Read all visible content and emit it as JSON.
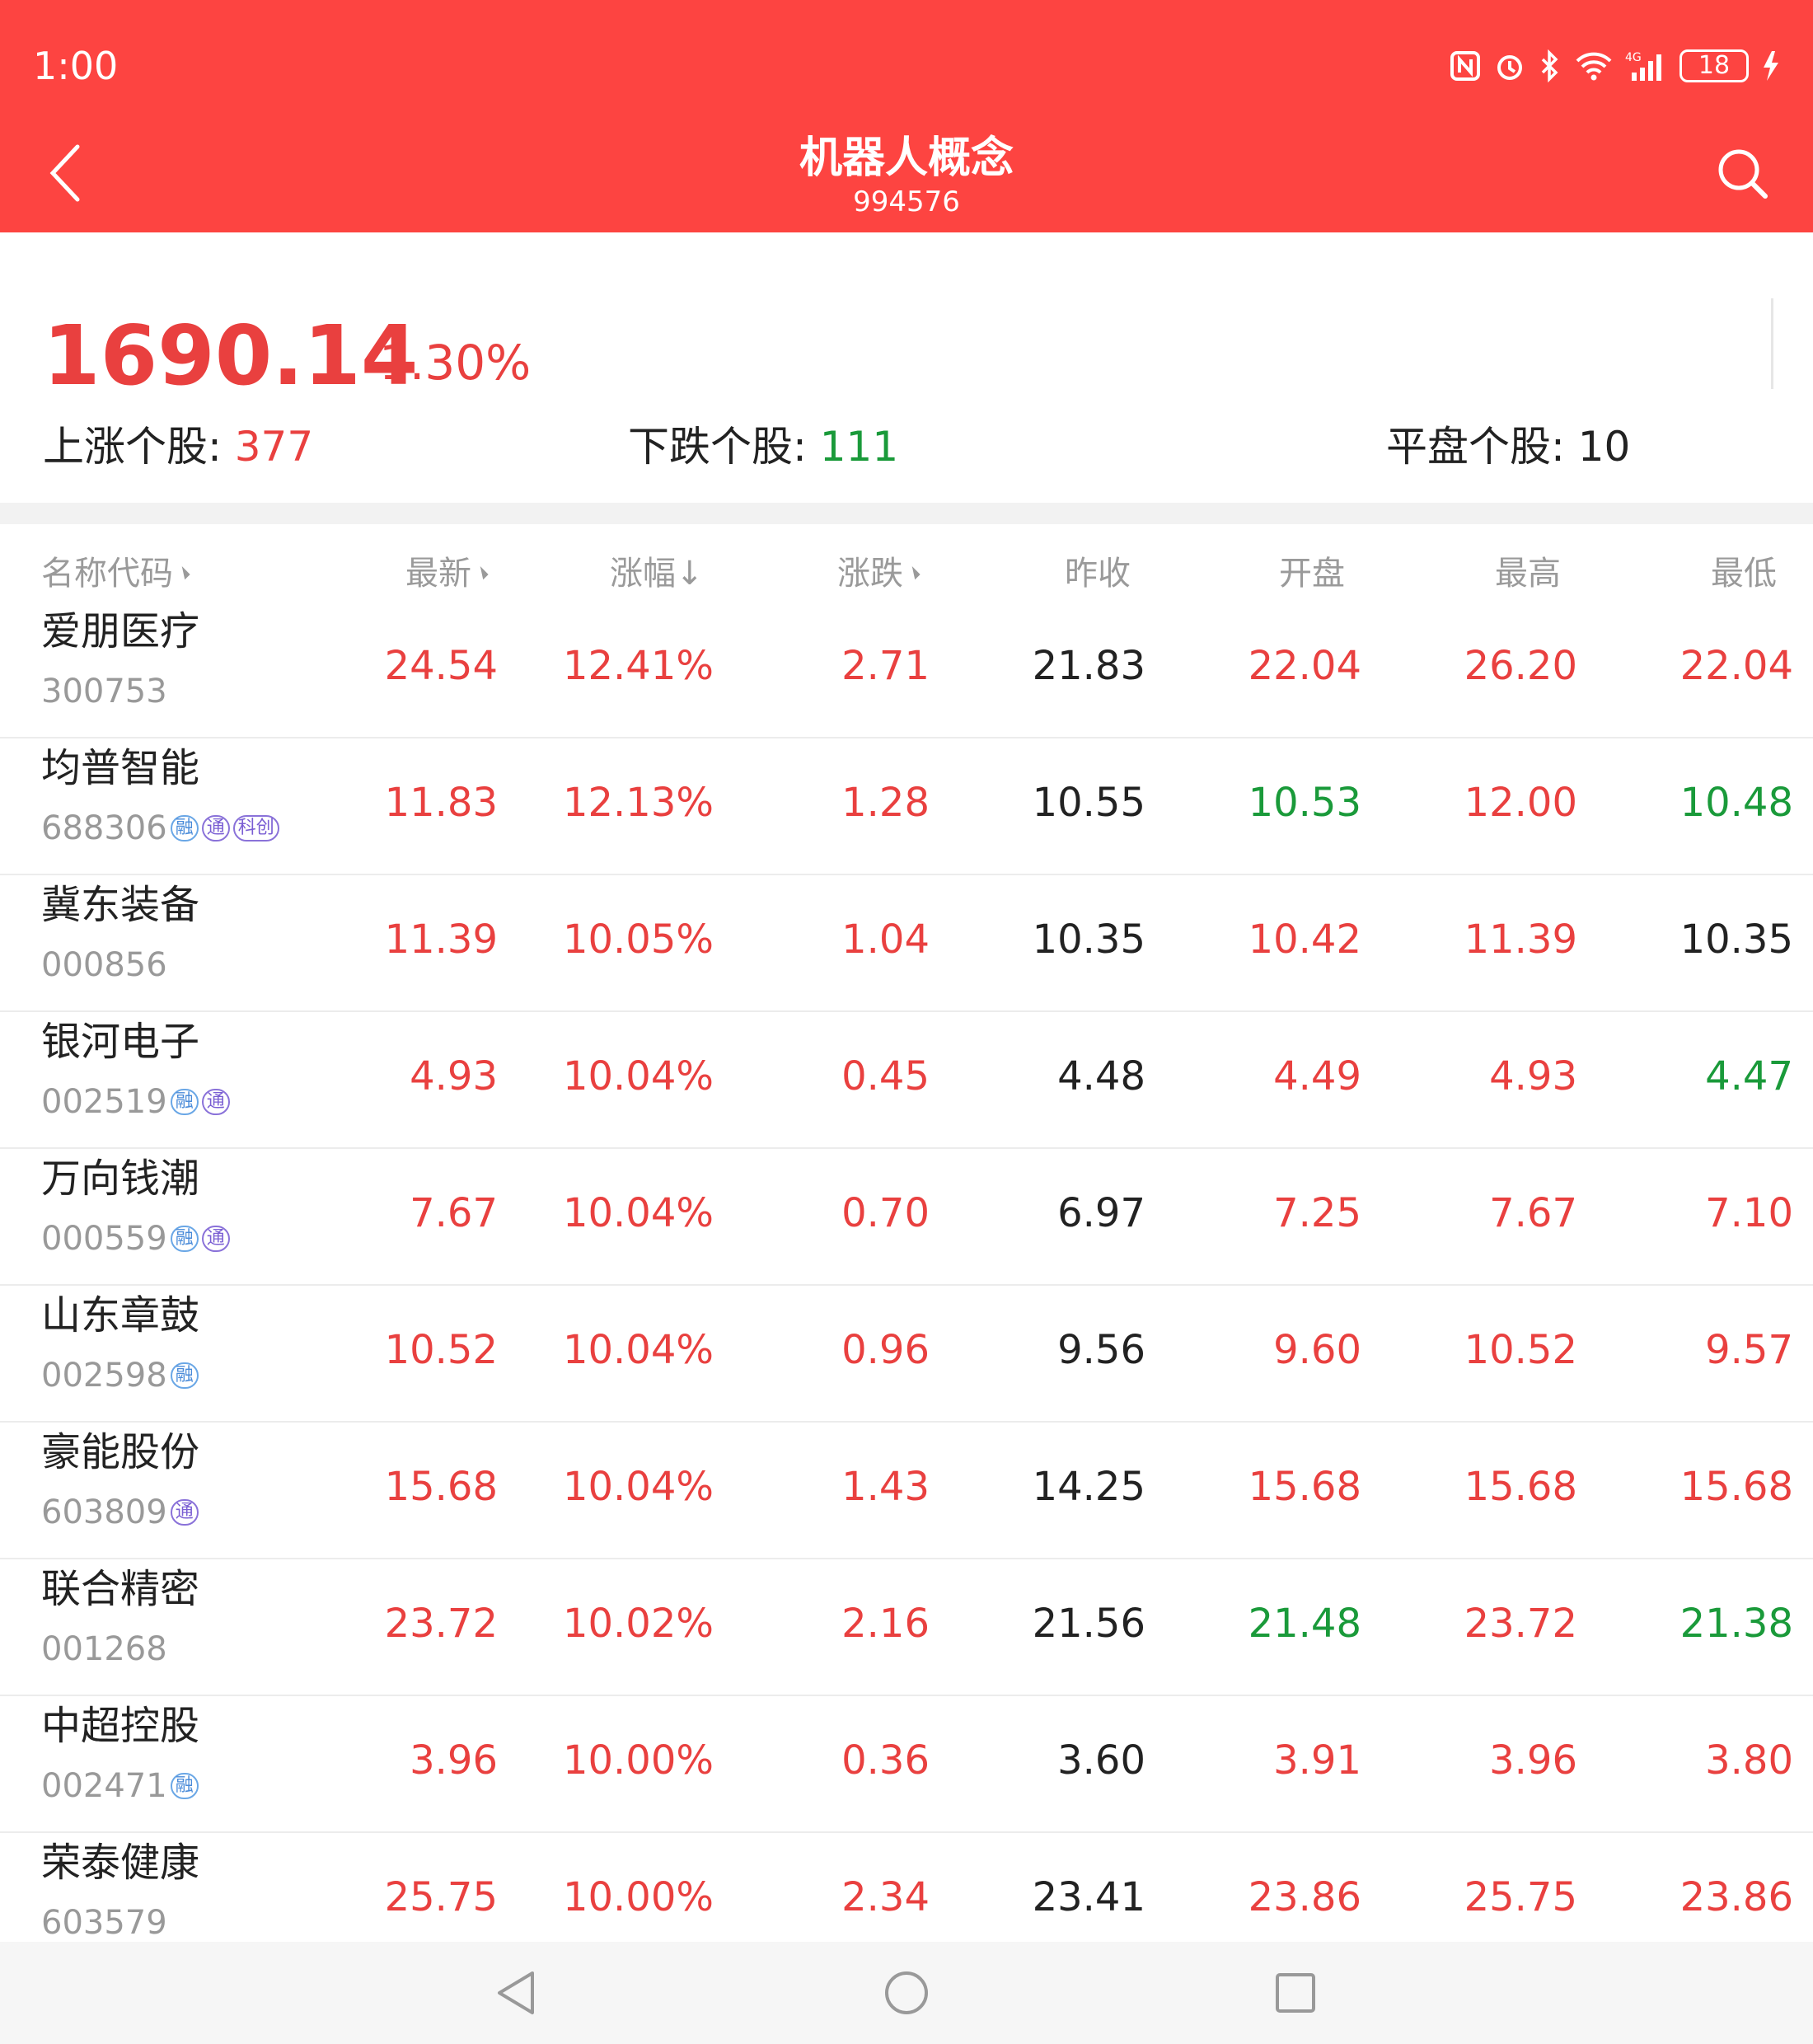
{
  "status_bar": {
    "time": "1:00",
    "battery": "18",
    "network": "4G"
  },
  "header": {
    "title": "机器人概念",
    "code": "994576"
  },
  "summary": {
    "price": "1690.14",
    "change_pct": "1.30%",
    "up_label": "上涨个股: ",
    "up_count": "377",
    "down_label": "下跌个股: ",
    "down_count": "111",
    "flat_label": "平盘个股: ",
    "flat_count": "10"
  },
  "columns": [
    "名称代码",
    "最新",
    "涨幅↓",
    "涨跌",
    "昨收",
    "开盘",
    "最高",
    "最低"
  ],
  "colors": {
    "header_red": "#fd4441",
    "up": "#e9403f",
    "down": "#1a9a3a",
    "flat": "#222222"
  },
  "rows": [
    {
      "name": "爱朋医疗",
      "code": "300753",
      "tags": [],
      "latest": "24.54",
      "pct": "12.41%",
      "chg": "2.71",
      "prev": "21.83",
      "open": "22.04",
      "high": "26.20",
      "low": "22.04",
      "open_dir": "up",
      "high_dir": "up",
      "low_dir": "up"
    },
    {
      "name": "均普智能",
      "code": "688306",
      "tags": [
        "融",
        "通",
        "科创"
      ],
      "latest": "11.83",
      "pct": "12.13%",
      "chg": "1.28",
      "prev": "10.55",
      "open": "10.53",
      "high": "12.00",
      "low": "10.48",
      "open_dir": "down",
      "high_dir": "up",
      "low_dir": "down"
    },
    {
      "name": "冀东装备",
      "code": "000856",
      "tags": [],
      "latest": "11.39",
      "pct": "10.05%",
      "chg": "1.04",
      "prev": "10.35",
      "open": "10.42",
      "high": "11.39",
      "low": "10.35",
      "open_dir": "up",
      "high_dir": "up",
      "low_dir": "flat"
    },
    {
      "name": "银河电子",
      "code": "002519",
      "tags": [
        "融",
        "通"
      ],
      "latest": "4.93",
      "pct": "10.04%",
      "chg": "0.45",
      "prev": "4.48",
      "open": "4.49",
      "high": "4.93",
      "low": "4.47",
      "open_dir": "up",
      "high_dir": "up",
      "low_dir": "down"
    },
    {
      "name": "万向钱潮",
      "code": "000559",
      "tags": [
        "融",
        "通"
      ],
      "latest": "7.67",
      "pct": "10.04%",
      "chg": "0.70",
      "prev": "6.97",
      "open": "7.25",
      "high": "7.67",
      "low": "7.10",
      "open_dir": "up",
      "high_dir": "up",
      "low_dir": "up"
    },
    {
      "name": "山东章鼓",
      "code": "002598",
      "tags": [
        "融"
      ],
      "latest": "10.52",
      "pct": "10.04%",
      "chg": "0.96",
      "prev": "9.56",
      "open": "9.60",
      "high": "10.52",
      "low": "9.57",
      "open_dir": "up",
      "high_dir": "up",
      "low_dir": "up"
    },
    {
      "name": "豪能股份",
      "code": "603809",
      "tags": [
        "通"
      ],
      "latest": "15.68",
      "pct": "10.04%",
      "chg": "1.43",
      "prev": "14.25",
      "open": "15.68",
      "high": "15.68",
      "low": "15.68",
      "open_dir": "up",
      "high_dir": "up",
      "low_dir": "up"
    },
    {
      "name": "联合精密",
      "code": "001268",
      "tags": [],
      "latest": "23.72",
      "pct": "10.02%",
      "chg": "2.16",
      "prev": "21.56",
      "open": "21.48",
      "high": "23.72",
      "low": "21.38",
      "open_dir": "down",
      "high_dir": "up",
      "low_dir": "down"
    },
    {
      "name": "中超控股",
      "code": "002471",
      "tags": [
        "融"
      ],
      "latest": "3.96",
      "pct": "10.00%",
      "chg": "0.36",
      "prev": "3.60",
      "open": "3.91",
      "high": "3.96",
      "low": "3.80",
      "open_dir": "up",
      "high_dir": "up",
      "low_dir": "up"
    },
    {
      "name": "荣泰健康",
      "code": "603579",
      "tags": [],
      "latest": "25.75",
      "pct": "10.00%",
      "chg": "2.34",
      "prev": "23.41",
      "open": "23.86",
      "high": "25.75",
      "low": "23.86",
      "open_dir": "up",
      "high_dir": "up",
      "low_dir": "up"
    }
  ]
}
